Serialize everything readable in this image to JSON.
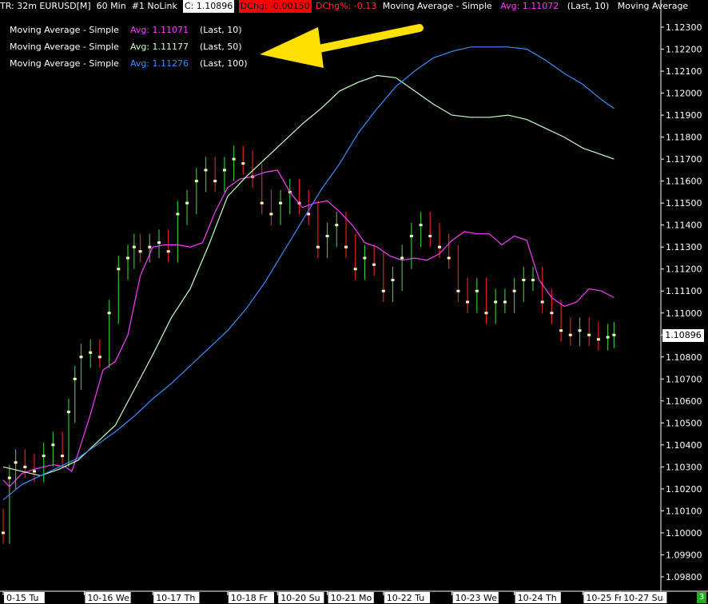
{
  "header": {
    "prefix": "TR: 32m EURUSD[M]",
    "interval": "60 Min",
    "link": "#1 NoLink",
    "close": "C: 1.10896",
    "dchg": "DChg: -0.00150",
    "dchg_pct": "DChg%: -0.13",
    "study": "Moving Average - Simple",
    "study_avg": "Avg: 1.11072",
    "study_last": "(Last, 10)",
    "study2": "Moving Average"
  },
  "legend": [
    {
      "label": "Moving Average - Simple",
      "avg": "Avg: 1.11071",
      "last": "(Last, 10)",
      "color": "#ff3cff"
    },
    {
      "label": "Moving Average - Simple",
      "avg": "Avg: 1.11177",
      "last": "(Last, 50)",
      "color": "#c8ffc8"
    },
    {
      "label": "Moving Average - Simple",
      "avg": "Avg: 1.11276",
      "last": "(Last, 100)",
      "color": "#3c8cff"
    }
  ],
  "price_badge": "1.10896",
  "page_badge": "3",
  "arrow_color": "#ffe000",
  "chart_data": {
    "type": "line",
    "y_ticks": [
      "1.12300",
      "1.12200",
      "1.12100",
      "1.12000",
      "1.11900",
      "1.11800",
      "1.11700",
      "1.11600",
      "1.11500",
      "1.11400",
      "1.11300",
      "1.11200",
      "1.11100",
      "1.11000",
      "1.10900",
      "1.10800",
      "1.10700",
      "1.10600",
      "1.10500",
      "1.10400",
      "1.10300",
      "1.10200",
      "1.10100",
      "1.10000",
      "1.09900",
      "1.09800"
    ],
    "ylim": [
      1.0975,
      1.1235
    ],
    "x_ticks": [
      "0-15 Tu",
      "10-16 We",
      "10-17 Th",
      "10-18 Fr",
      "10-20 Su",
      "10-21 Mo",
      "10-22 Tu",
      "10-23 We",
      "10-24 Th",
      "10-25 Fr",
      "10-27 Su"
    ],
    "x_tick_pos": [
      0.0,
      1.3,
      2.4,
      3.6,
      4.4,
      5.2,
      6.1,
      7.2,
      8.2,
      9.3,
      9.9
    ],
    "xlim": [
      0,
      10.0
    ],
    "grid": false,
    "series": [
      {
        "name": "Moving Average - Simple (Last, 10)",
        "color": "#ff3cff",
        "x": [
          0.0,
          0.1,
          0.3,
          0.5,
          0.8,
          1.0,
          1.1,
          1.2,
          1.4,
          1.6,
          1.8,
          2.0,
          2.2,
          2.4,
          2.6,
          2.8,
          3.0,
          3.2,
          3.4,
          3.6,
          3.8,
          4.0,
          4.2,
          4.4,
          4.6,
          4.8,
          5.0,
          5.2,
          5.4,
          5.6,
          5.8,
          6.0,
          6.2,
          6.4,
          6.6,
          6.8,
          7.0,
          7.2,
          7.4,
          7.6,
          7.8,
          8.0,
          8.2,
          8.4,
          8.6,
          8.8,
          9.0,
          9.2,
          9.4,
          9.6,
          9.8
        ],
        "values": [
          1.1024,
          1.1021,
          1.1027,
          1.1029,
          1.1031,
          1.103,
          1.1028,
          1.1036,
          1.1054,
          1.1074,
          1.1078,
          1.109,
          1.1117,
          1.113,
          1.1131,
          1.1131,
          1.113,
          1.1132,
          1.1146,
          1.1157,
          1.1161,
          1.1162,
          1.1164,
          1.1165,
          1.1155,
          1.1148,
          1.115,
          1.1151,
          1.1146,
          1.114,
          1.1132,
          1.113,
          1.1126,
          1.1124,
          1.1125,
          1.1124,
          1.1127,
          1.1133,
          1.1137,
          1.1136,
          1.1136,
          1.1131,
          1.1135,
          1.1133,
          1.1115,
          1.1107,
          1.1103,
          1.1105,
          1.1111,
          1.111,
          1.1107
        ]
      },
      {
        "name": "Moving Average - Simple (Last, 50)",
        "color": "#c8ffc8",
        "x": [
          0.0,
          0.3,
          0.6,
          0.9,
          1.2,
          1.5,
          1.8,
          2.1,
          2.4,
          2.7,
          3.0,
          3.3,
          3.6,
          3.9,
          4.2,
          4.5,
          4.8,
          5.1,
          5.4,
          5.7,
          6.0,
          6.3,
          6.6,
          6.9,
          7.2,
          7.5,
          7.8,
          8.1,
          8.4,
          8.7,
          9.0,
          9.3,
          9.6,
          9.8
        ],
        "values": [
          1.103,
          1.1028,
          1.1026,
          1.1029,
          1.1033,
          1.1041,
          1.1049,
          1.1065,
          1.1081,
          1.1098,
          1.1111,
          1.1131,
          1.1153,
          1.1162,
          1.117,
          1.1178,
          1.1186,
          1.1193,
          1.1201,
          1.1205,
          1.1208,
          1.1207,
          1.1201,
          1.1195,
          1.119,
          1.1189,
          1.1189,
          1.119,
          1.1188,
          1.1184,
          1.118,
          1.1175,
          1.1172,
          1.117
        ]
      },
      {
        "name": "Moving Average - Simple (Last, 100)",
        "color": "#3c8cff",
        "x": [
          0.0,
          0.3,
          0.6,
          0.9,
          1.2,
          1.5,
          1.8,
          2.1,
          2.4,
          2.7,
          3.0,
          3.3,
          3.6,
          3.9,
          4.2,
          4.5,
          4.8,
          5.1,
          5.4,
          5.7,
          6.0,
          6.3,
          6.6,
          6.9,
          7.2,
          7.5,
          7.8,
          8.1,
          8.4,
          8.7,
          9.0,
          9.3,
          9.6,
          9.8
        ],
        "values": [
          1.1015,
          1.1022,
          1.1026,
          1.103,
          1.1034,
          1.104,
          1.1046,
          1.1053,
          1.1061,
          1.1068,
          1.1076,
          1.1084,
          1.1092,
          1.1102,
          1.1114,
          1.1128,
          1.1142,
          1.1156,
          1.1168,
          1.1182,
          1.1193,
          1.1203,
          1.121,
          1.1216,
          1.1219,
          1.1221,
          1.1221,
          1.1221,
          1.122,
          1.1215,
          1.1209,
          1.1204,
          1.1197,
          1.1193
        ]
      }
    ],
    "candles": {
      "up_color": "#30c030",
      "down_color": "#e02020",
      "marker_color": "#ffffc0",
      "x": [
        0.0,
        0.1,
        0.2,
        0.35,
        0.5,
        0.65,
        0.8,
        0.95,
        1.05,
        1.15,
        1.25,
        1.4,
        1.55,
        1.7,
        1.85,
        2.0,
        2.1,
        2.2,
        2.35,
        2.5,
        2.65,
        2.8,
        2.95,
        3.1,
        3.25,
        3.4,
        3.55,
        3.7,
        3.85,
        4.0,
        4.15,
        4.3,
        4.45,
        4.6,
        4.75,
        4.9,
        5.05,
        5.2,
        5.35,
        5.5,
        5.65,
        5.8,
        5.95,
        6.1,
        6.25,
        6.4,
        6.55,
        6.7,
        6.85,
        7.0,
        7.15,
        7.3,
        7.45,
        7.6,
        7.75,
        7.9,
        8.05,
        8.2,
        8.35,
        8.5,
        8.65,
        8.8,
        8.95,
        9.1,
        9.25,
        9.4,
        9.55,
        9.7,
        9.8
      ],
      "open": [
        1.1005,
        1.1,
        1.1025,
        1.1032,
        1.103,
        1.1028,
        1.1035,
        1.104,
        1.1035,
        1.1055,
        1.107,
        1.108,
        1.1082,
        1.108,
        1.11,
        1.112,
        1.1125,
        1.113,
        1.1128,
        1.113,
        1.1132,
        1.1128,
        1.1145,
        1.115,
        1.116,
        1.1165,
        1.116,
        1.1165,
        1.117,
        1.1168,
        1.1162,
        1.115,
        1.1145,
        1.115,
        1.1155,
        1.115,
        1.1145,
        1.113,
        1.1135,
        1.114,
        1.113,
        1.112,
        1.1125,
        1.1122,
        1.111,
        1.1115,
        1.1125,
        1.1135,
        1.114,
        1.1135,
        1.113,
        1.1125,
        1.111,
        1.1105,
        1.111,
        1.11,
        1.1105,
        1.1105,
        1.111,
        1.1115,
        1.1115,
        1.1105,
        1.11,
        1.1092,
        1.109,
        1.1092,
        1.109,
        1.1088,
        1.1089
      ],
      "close": [
        1.1,
        1.1025,
        1.1032,
        1.103,
        1.1028,
        1.1035,
        1.104,
        1.1035,
        1.1055,
        1.107,
        1.108,
        1.1082,
        1.108,
        1.11,
        1.112,
        1.1125,
        1.113,
        1.1128,
        1.113,
        1.1132,
        1.1128,
        1.1145,
        1.115,
        1.116,
        1.1165,
        1.116,
        1.1165,
        1.117,
        1.1168,
        1.1162,
        1.115,
        1.1145,
        1.115,
        1.1155,
        1.115,
        1.1145,
        1.113,
        1.1135,
        1.114,
        1.113,
        1.112,
        1.1125,
        1.1122,
        1.111,
        1.1115,
        1.1125,
        1.1135,
        1.114,
        1.1135,
        1.113,
        1.1125,
        1.111,
        1.1105,
        1.111,
        1.11,
        1.1105,
        1.1105,
        1.111,
        1.1115,
        1.1115,
        1.1105,
        1.11,
        1.1092,
        1.109,
        1.1092,
        1.109,
        1.1088,
        1.1089,
        1.109
      ]
    }
  }
}
